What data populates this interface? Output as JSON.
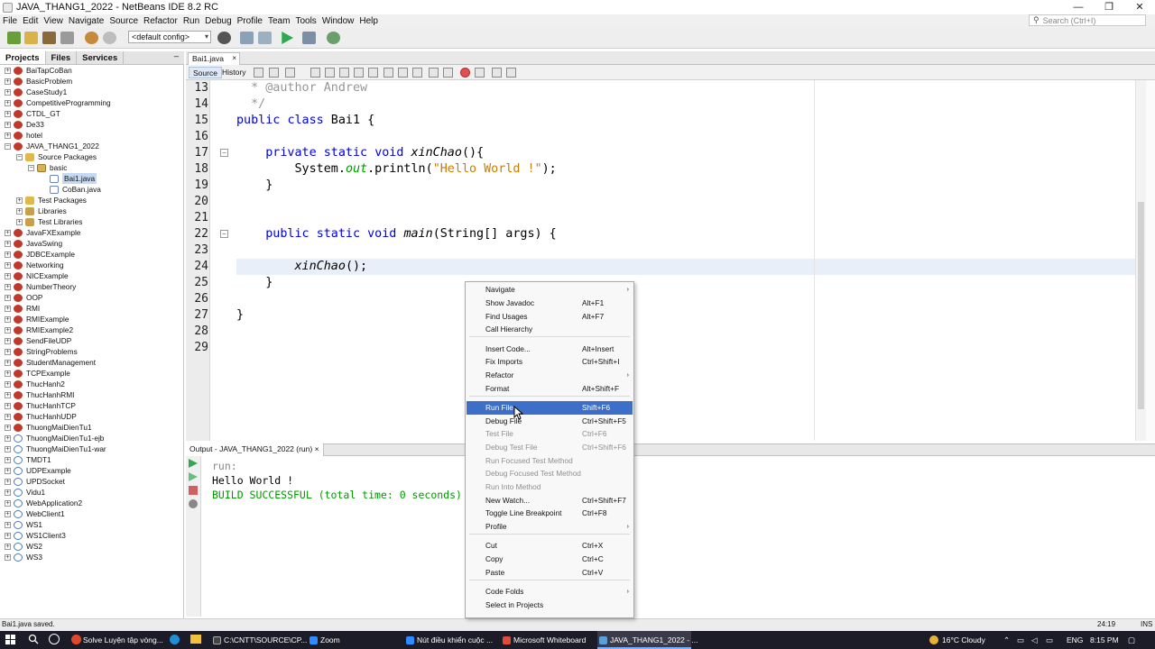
{
  "window": {
    "title": "JAVA_THANG1_2022 - NetBeans IDE 8.2 RC",
    "buttons": {
      "minimize": "—",
      "maximize": "❐",
      "close": "✕"
    }
  },
  "menubar": {
    "items": [
      "File",
      "Edit",
      "View",
      "Navigate",
      "Source",
      "Refactor",
      "Run",
      "Debug",
      "Profile",
      "Team",
      "Tools",
      "Window",
      "Help"
    ],
    "search_placeholder": "Search (Ctrl+I)"
  },
  "toolbar": {
    "config": "<default config>"
  },
  "projects_panel": {
    "tabs": [
      "Projects",
      "Files",
      "Services"
    ],
    "minimize": "–",
    "tree": [
      {
        "label": "BaiTapCoBan",
        "toggle": "+"
      },
      {
        "label": "BasicProblem",
        "toggle": "+"
      },
      {
        "label": "CaseStudy1",
        "toggle": "+"
      },
      {
        "label": "CompetitiveProgramming",
        "toggle": "+"
      },
      {
        "label": "CTDL_GT",
        "toggle": "+"
      },
      {
        "label": "De33",
        "toggle": "+"
      },
      {
        "label": "hotel",
        "toggle": "+"
      },
      {
        "label": "JAVA_THANG1_2022",
        "toggle": "−"
      },
      {
        "label": "Source Packages",
        "toggle": "−"
      },
      {
        "label": "basic",
        "toggle": "−"
      },
      {
        "label": "Bai1.java",
        "toggle": ""
      },
      {
        "label": "CoBan.java",
        "toggle": ""
      },
      {
        "label": "Test Packages",
        "toggle": "+"
      },
      {
        "label": "Libraries",
        "toggle": "+"
      },
      {
        "label": "Test Libraries",
        "toggle": "+"
      },
      {
        "label": "JavaFXExample",
        "toggle": "+"
      },
      {
        "label": "JavaSwing",
        "toggle": "+"
      },
      {
        "label": "JDBCExample",
        "toggle": "+"
      },
      {
        "label": "Networking",
        "toggle": "+"
      },
      {
        "label": "NICExample",
        "toggle": "+"
      },
      {
        "label": "NumberTheory",
        "toggle": "+"
      },
      {
        "label": "OOP",
        "toggle": "+"
      },
      {
        "label": "RMI",
        "toggle": "+"
      },
      {
        "label": "RMIExample",
        "toggle": "+"
      },
      {
        "label": "RMIExample2",
        "toggle": "+"
      },
      {
        "label": "SendFileUDP",
        "toggle": "+"
      },
      {
        "label": "StringProblems",
        "toggle": "+"
      },
      {
        "label": "StudentManagement",
        "toggle": "+"
      },
      {
        "label": "TCPExample",
        "toggle": "+"
      },
      {
        "label": "ThucHanh2",
        "toggle": "+"
      },
      {
        "label": "ThucHanhRMI",
        "toggle": "+"
      },
      {
        "label": "ThucHanhTCP",
        "toggle": "+"
      },
      {
        "label": "ThucHanhUDP",
        "toggle": "+"
      },
      {
        "label": "ThuongMaiDienTu1",
        "toggle": "+"
      },
      {
        "label": "ThuongMaiDienTu1-ejb",
        "toggle": "+"
      },
      {
        "label": "ThuongMaiDienTu1-war",
        "toggle": "+"
      },
      {
        "label": "TMDT1",
        "toggle": "+"
      },
      {
        "label": "UDPExample",
        "toggle": "+"
      },
      {
        "label": "UPDSocket",
        "toggle": "+"
      },
      {
        "label": "Vidu1",
        "toggle": "+"
      },
      {
        "label": "WebApplication2",
        "toggle": "+"
      },
      {
        "label": "WebClient1",
        "toggle": "+"
      },
      {
        "label": "WS1",
        "toggle": "+"
      },
      {
        "label": "WS1Client3",
        "toggle": "+"
      },
      {
        "label": "WS2",
        "toggle": "+"
      },
      {
        "label": "WS3",
        "toggle": "+"
      }
    ]
  },
  "editor": {
    "file_tab": "Bai1.java",
    "file_tab_close": "×",
    "tabs": {
      "source": "Source",
      "history": "History"
    },
    "line_numbers": [
      "13",
      "14",
      "15",
      "16",
      "17",
      "18",
      "19",
      "20",
      "21",
      "22",
      "23",
      "24",
      "25",
      "26",
      "27",
      "28",
      "29"
    ],
    "code": {
      "l13": "* @author Andrew",
      "l14": "*/",
      "kw_public": "public",
      "kw_class": "class",
      "class_rest": " Bai1 {",
      "kw_private": "private",
      "kw_static": "static",
      "kw_void": "void",
      "method_xinchao": "xinChao",
      "xinchao_rest": "(){",
      "system": "System.",
      "out": "out",
      "println": ".println(",
      "hello_str": "\"Hello World !\"",
      "println_end": ");",
      "close_brace": "}",
      "method_main": "main",
      "main_rest": "(String[] args) {",
      "call_xinchao": "xinChao",
      "call_rest": "();"
    }
  },
  "output": {
    "tab": "Output - JAVA_THANG1_2022 (run)",
    "tab_close": "×",
    "lines": [
      "run:",
      "Hello World !",
      "BUILD SUCCESSFUL (total time: 0 seconds)"
    ]
  },
  "context_menu": {
    "items": [
      {
        "label": "Navigate",
        "shortcut": "",
        "submenu": "›"
      },
      {
        "label": "Show Javadoc",
        "shortcut": "Alt+F1"
      },
      {
        "label": "Find Usages",
        "shortcut": "Alt+F7"
      },
      {
        "label": "Call Hierarchy",
        "shortcut": ""
      },
      {
        "label": "Insert Code...",
        "shortcut": "Alt+Insert"
      },
      {
        "label": "Fix Imports",
        "shortcut": "Ctrl+Shift+I"
      },
      {
        "label": "Refactor",
        "shortcut": "",
        "submenu": "›"
      },
      {
        "label": "Format",
        "shortcut": "Alt+Shift+F"
      },
      {
        "label": "Run File",
        "shortcut": "Shift+F6"
      },
      {
        "label": "Debug File",
        "shortcut": "Ctrl+Shift+F5"
      },
      {
        "label": "Test File",
        "shortcut": "Ctrl+F6"
      },
      {
        "label": "Debug Test File",
        "shortcut": "Ctrl+Shift+F6"
      },
      {
        "label": "Run Focused Test Method",
        "shortcut": ""
      },
      {
        "label": "Debug Focused Test Method",
        "shortcut": ""
      },
      {
        "label": "Run Into Method",
        "shortcut": ""
      },
      {
        "label": "New Watch...",
        "shortcut": "Ctrl+Shift+F7"
      },
      {
        "label": "Toggle Line Breakpoint",
        "shortcut": "Ctrl+F8"
      },
      {
        "label": "Profile",
        "shortcut": "",
        "submenu": "›"
      },
      {
        "label": "Cut",
        "shortcut": "Ctrl+X"
      },
      {
        "label": "Copy",
        "shortcut": "Ctrl+C"
      },
      {
        "label": "Paste",
        "shortcut": "Ctrl+V"
      },
      {
        "label": "Code Folds",
        "shortcut": "",
        "submenu": "›"
      },
      {
        "label": "Select in Projects",
        "shortcut": ""
      }
    ]
  },
  "statusbar": {
    "message": "Bai1.java saved.",
    "position": "24:19",
    "mode": "INS"
  },
  "taskbar": {
    "tasks": [
      "Solve Luyện tập vòng...",
      "C:\\CNTT\\SOURCE\\CP...",
      "Zoom",
      "Nút điều khiển cuộc ...",
      "Microsoft Whiteboard",
      "JAVA_THANG1_2022 - ..."
    ],
    "weather": "16°C  Cloudy",
    "lang": "ENG",
    "time": "8:15 PM"
  },
  "colors": {
    "keyword": "#0000e6",
    "string": "#ce7b00",
    "comment": "#969696",
    "build_success": "#009900",
    "menu_highlight": "#3d6fc9"
  }
}
